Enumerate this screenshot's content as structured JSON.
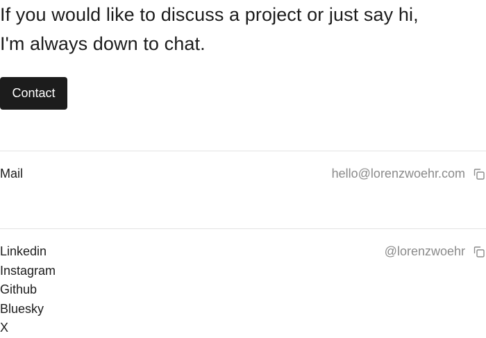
{
  "intro": {
    "line1": "If you would like to discuss a project or just say hi,",
    "line2": "I'm always down to chat."
  },
  "contact_button": {
    "label": "Contact"
  },
  "mail_row": {
    "label": "Mail",
    "value": "hello@lorenzwoehr.com",
    "icon": "copy-icon"
  },
  "social_row": {
    "handle": "@lorenzwoehr",
    "icon": "copy-icon",
    "links": [
      "Linkedin",
      "Instagram",
      "Github",
      "Bluesky",
      "X"
    ]
  },
  "colors": {
    "text": "#1b1b1b",
    "muted": "#8a8a8a",
    "button_bg": "#1c1c1c",
    "button_text": "#ffffff",
    "divider": "#e3e3e3"
  }
}
